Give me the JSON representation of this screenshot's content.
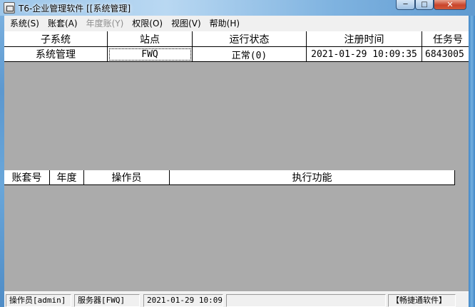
{
  "window": {
    "title": "T6-企业管理软件 [[系统管理]",
    "minimize_glyph": "─",
    "maximize_glyph": "□",
    "close_glyph": "✕"
  },
  "menu": [
    {
      "label": "系统(S)",
      "enabled": true
    },
    {
      "label": "账套(A)",
      "enabled": true
    },
    {
      "label": "年度账(Y)",
      "enabled": false
    },
    {
      "label": "权限(O)",
      "enabled": true
    },
    {
      "label": "视图(V)",
      "enabled": true
    },
    {
      "label": "帮助(H)",
      "enabled": true
    }
  ],
  "upper_grid": {
    "columns": [
      "子系统",
      "站点",
      "运行状态",
      "注册时间",
      "任务号"
    ],
    "rows": [
      [
        "系统管理",
        "FWQ",
        "正常(0)",
        "2021-01-29 10:09:35",
        "6843005"
      ]
    ]
  },
  "scrollbar": {
    "left_arrow": "◂",
    "right_arrow": "▸"
  },
  "lower_grid": {
    "columns": [
      "账套号",
      "年度",
      "操作员",
      "执行功能"
    ]
  },
  "statusbar": {
    "operator": "操作员[admin]",
    "server": "服务器[FWQ]",
    "datetime": "2021-01-29 10:09",
    "brand": "【畅捷通软件】"
  }
}
